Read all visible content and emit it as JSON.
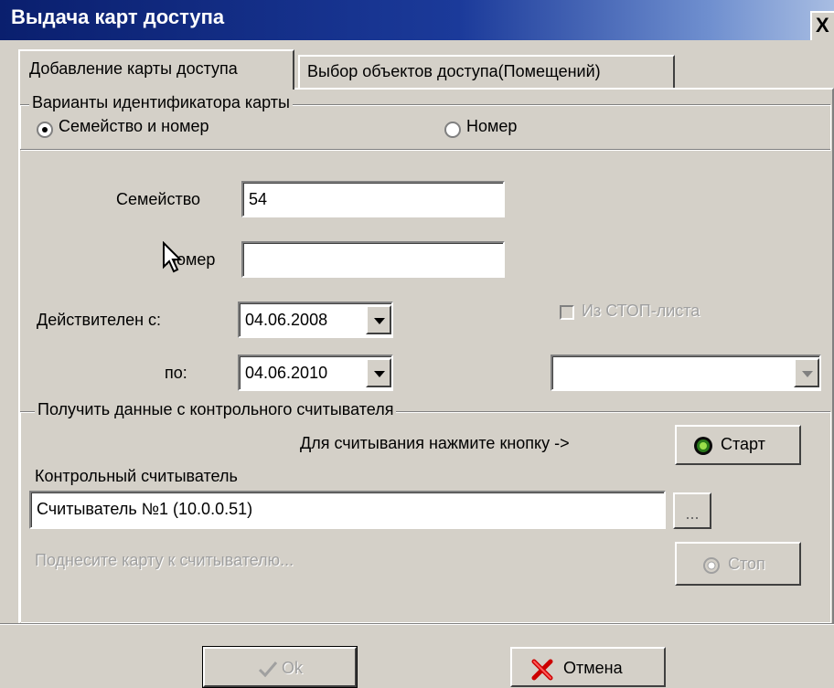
{
  "window": {
    "title": "Выдача карт доступа",
    "close_label": "X"
  },
  "tabs": [
    {
      "label": "Добавление карты доступа",
      "active": true
    },
    {
      "label": "Выбор объектов доступа(Помещений)",
      "active": false
    }
  ],
  "id_variants": {
    "legend": "Варианты идентификатора карты",
    "options": [
      {
        "label": "Семейство и номер",
        "selected": true
      },
      {
        "label": "Номер",
        "selected": false
      }
    ]
  },
  "fields": {
    "family_label": "Семейство",
    "family_value": "54",
    "number_label": "Номер",
    "number_value": "",
    "valid_from_label": "Действителен с:",
    "valid_from_value": "04.06.2008",
    "valid_to_label": "по:",
    "valid_to_value": "04.06.2010",
    "stoplist_label": "Из СТОП-листа",
    "stoplist_checked": false,
    "stoplist_select_value": ""
  },
  "reader_group": {
    "legend": "Получить данные с контрольного считывателя",
    "hint": "Для считывания нажмите кнопку ->",
    "start_label": "Старт",
    "reader_label": "Контрольный считыватель",
    "reader_value": "Считыватель №1 (10.0.0.51)",
    "browse_label": "...",
    "status_text": "Поднесите карту к считывателю...",
    "stop_label": "Стоп"
  },
  "footer": {
    "ok_label": "Ok",
    "cancel_label": "Отмена"
  },
  "colors": {
    "title_bar": "#0a1f6e",
    "dialog_bg": "#d4d0c8",
    "start_led": "#2a7a1a",
    "cancel_x": "#cc0000"
  }
}
